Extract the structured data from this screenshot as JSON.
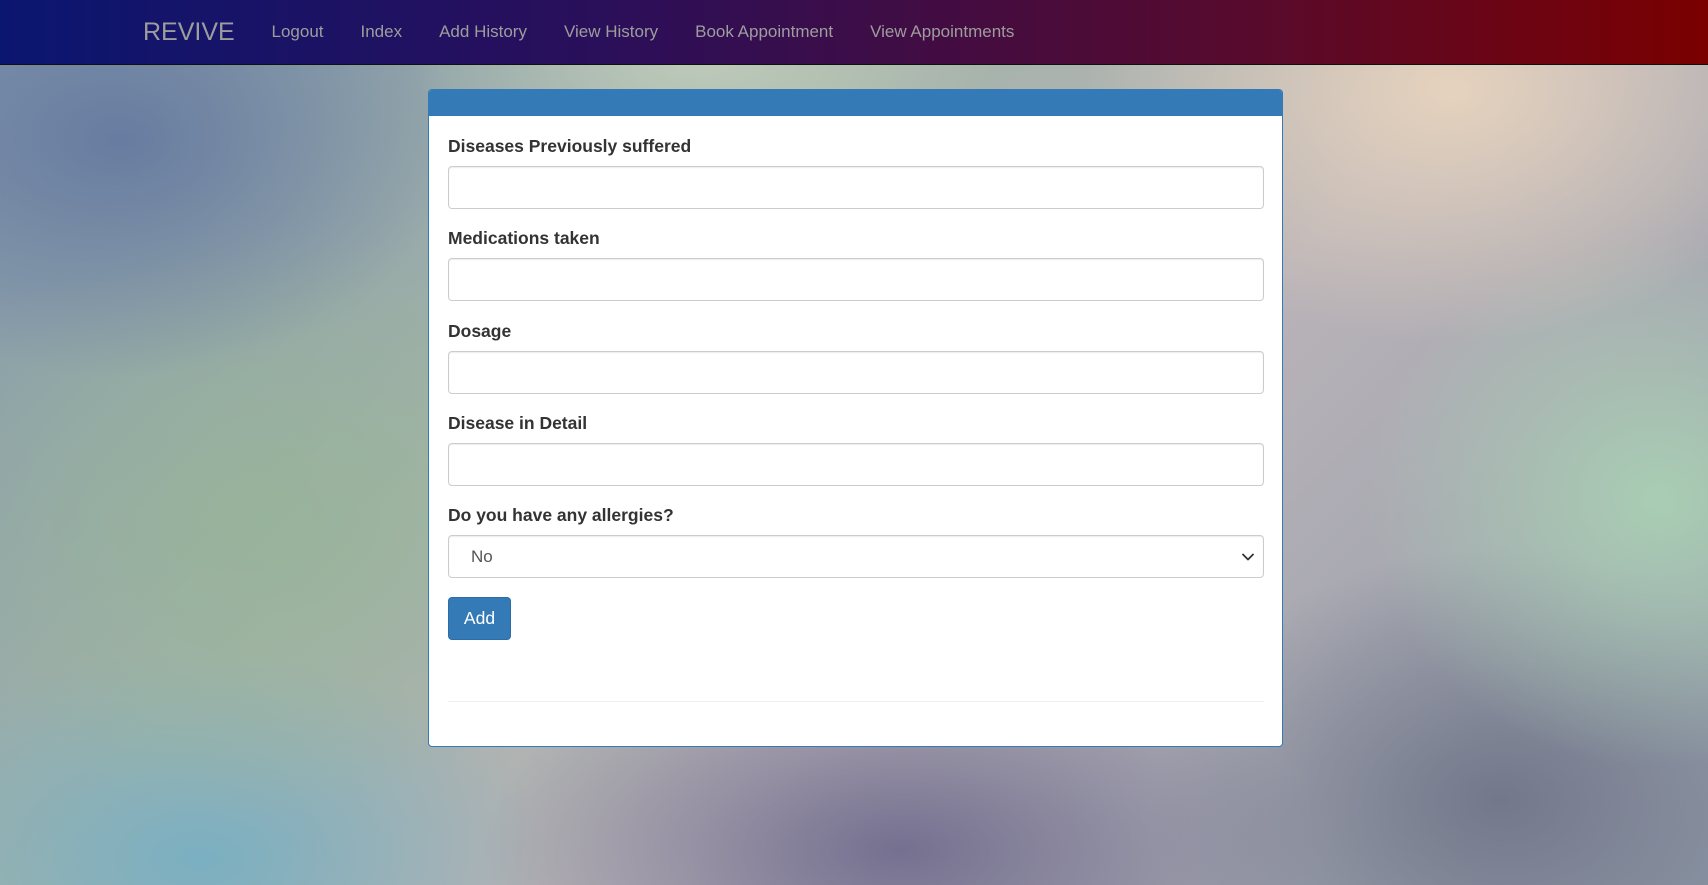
{
  "navbar": {
    "brand": "REVIVE",
    "items": [
      {
        "label": "Logout"
      },
      {
        "label": "Index"
      },
      {
        "label": "Add History"
      },
      {
        "label": "View History"
      },
      {
        "label": "Book Appointment"
      },
      {
        "label": "View Appointments"
      }
    ]
  },
  "form": {
    "fields": [
      {
        "label": "Diseases Previously suffered",
        "value": "",
        "placeholder": ""
      },
      {
        "label": "Medications taken",
        "value": "",
        "placeholder": ""
      },
      {
        "label": "Dosage",
        "value": "",
        "placeholder": ""
      },
      {
        "label": "Disease in Detail",
        "value": "",
        "placeholder": ""
      }
    ],
    "allergies": {
      "label": "Do you have any allergies?",
      "selected": "No"
    },
    "submit_label": "Add"
  },
  "colors": {
    "primary": "#337ab7",
    "nav_start": "#0b1670",
    "nav_end": "#7a0000"
  },
  "icons": {
    "select_arrow": "chevron-down-icon"
  }
}
